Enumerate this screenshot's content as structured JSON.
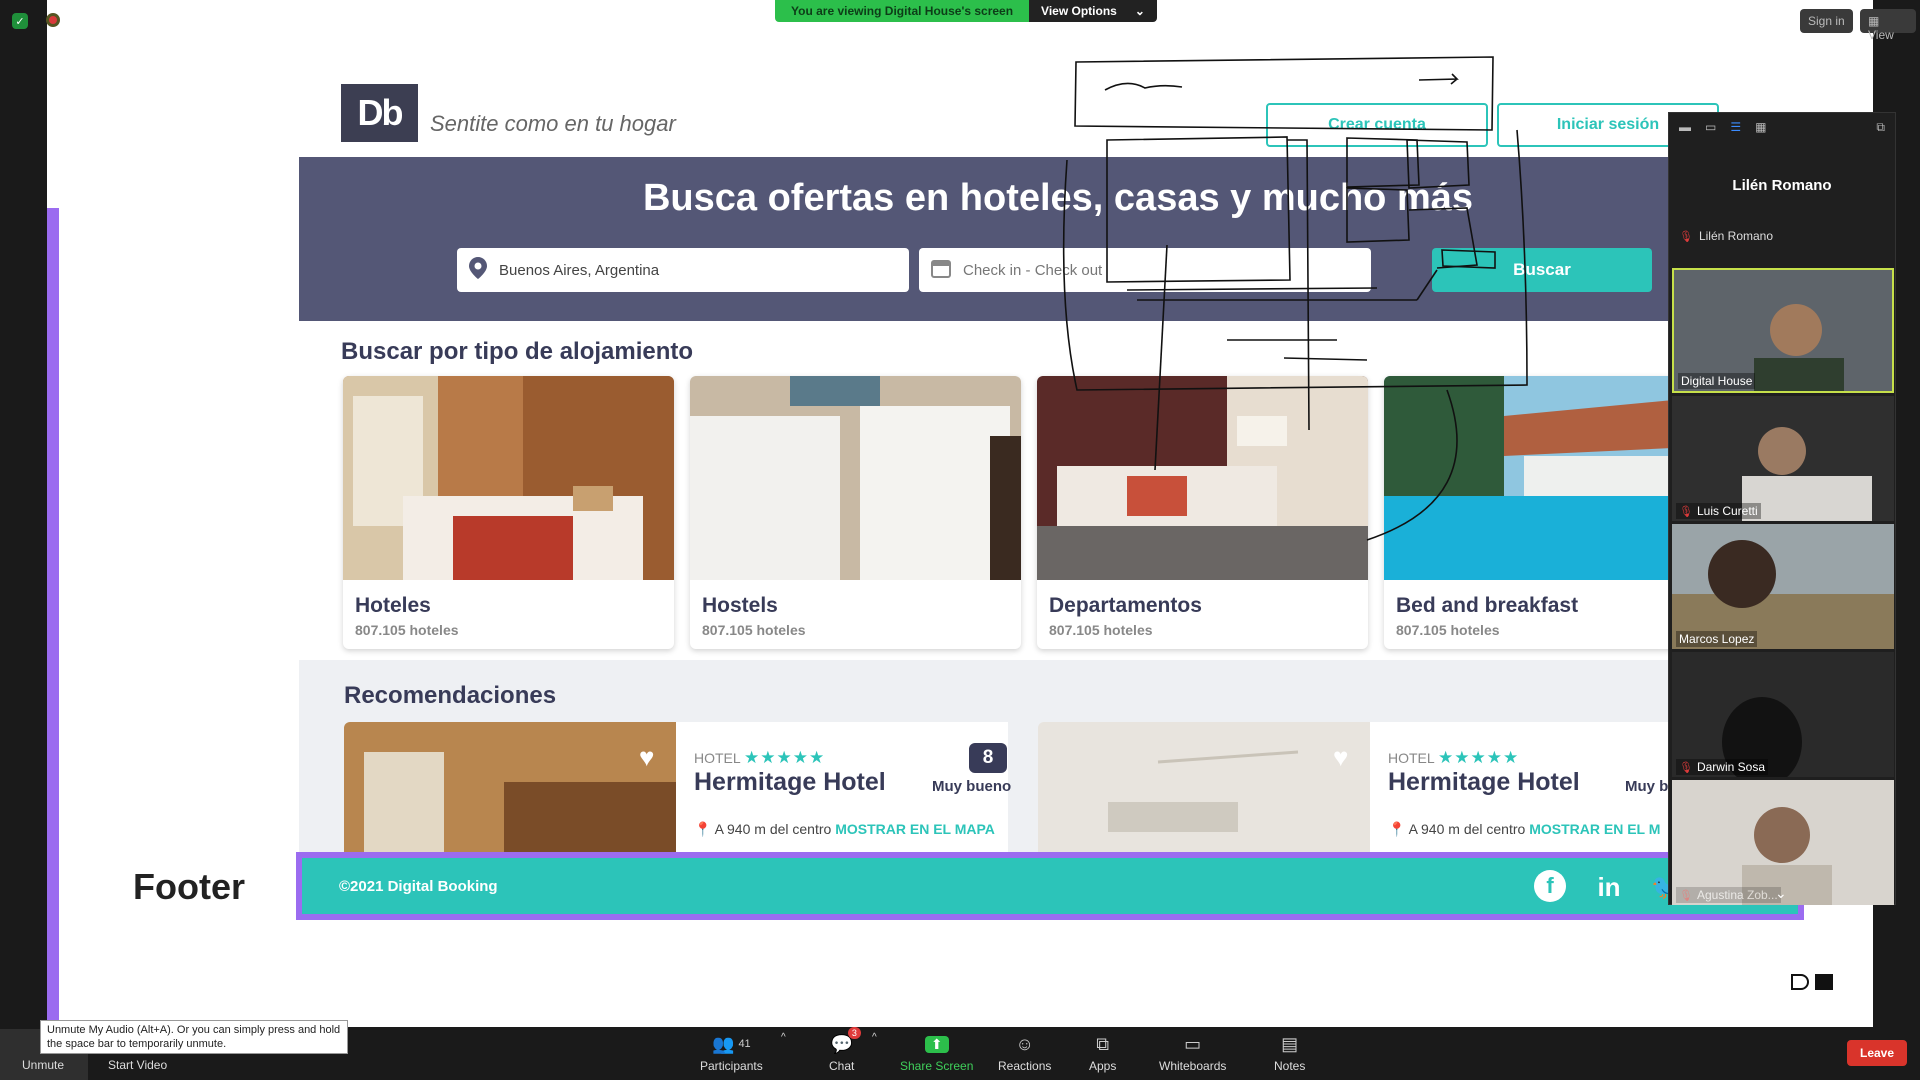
{
  "banner": {
    "text": "You are viewing Digital House's screen",
    "view_options": "View Options"
  },
  "top_right": {
    "sign_in": "Sign in",
    "view": "View"
  },
  "site": {
    "logo": "Db",
    "tagline": "Sentite como en tu hogar",
    "create_account": "Crear cuenta",
    "login": "Iniciar sesión",
    "hero_title": "Busca ofertas en hoteles, casas y mucho más",
    "location_value": "Buenos Aires, Argentina",
    "dates_placeholder": "Check in - Check out",
    "search_button": "Buscar",
    "categories_title": "Buscar por tipo de alojamiento",
    "categories": [
      {
        "name": "Hoteles",
        "count": "807.105 hoteles"
      },
      {
        "name": "Hostels",
        "count": "807.105 hoteles"
      },
      {
        "name": "Departamentos",
        "count": "807.105 hoteles"
      },
      {
        "name": "Bed and breakfast",
        "count": "807.105 hoteles"
      }
    ],
    "recommendations_title": "Recomendaciones",
    "recommendations": [
      {
        "category": "HOTEL",
        "stars": "★★★★★",
        "name": "Hermitage Hotel",
        "score": "8",
        "score_label": "Muy bueno",
        "distance": "A 940 m del centro",
        "map_link": "MOSTRAR EN EL MAPA"
      },
      {
        "category": "HOTEL",
        "stars": "★★★★★",
        "name": "Hermitage Hotel",
        "score": "",
        "score_label": "Muy b",
        "distance": "A 940 m del centro",
        "map_link": "MOSTRAR EN EL M"
      }
    ],
    "footer_label": "Footer",
    "footer_copy": "©2021 Digital Booking",
    "social": {
      "facebook": "f",
      "linkedin": "in",
      "twitter": "🐦"
    }
  },
  "panel": {
    "speaker": "Lilén Romano",
    "speaker_sub": "Lilén Romano",
    "participants": [
      {
        "name": "Digital House",
        "muted": false
      },
      {
        "name": "Luis Curetti",
        "muted": true
      },
      {
        "name": "Marcos Lopez",
        "muted": false
      },
      {
        "name": "Darwin Sosa",
        "muted": true
      },
      {
        "name": "Agustina Zob...",
        "muted": true
      }
    ]
  },
  "toolbar": {
    "unmute": "Unmute",
    "start_video": "Start Video",
    "participants": "Participants",
    "participants_count": "41",
    "chat": "Chat",
    "chat_badge": "3",
    "share_screen": "Share Screen",
    "reactions": "Reactions",
    "apps": "Apps",
    "whiteboards": "Whiteboards",
    "notes": "Notes",
    "leave": "Leave",
    "tooltip": "Unmute My Audio (Alt+A). Or you can simply press and hold the space bar to temporarily unmute."
  },
  "colors": {
    "accent": "#2cc4b9",
    "dark": "#383b58",
    "hero": "#545776",
    "purple": "#9b6cf0",
    "zoom_green": "#2cbf4b",
    "leave_red": "#d9342b"
  }
}
